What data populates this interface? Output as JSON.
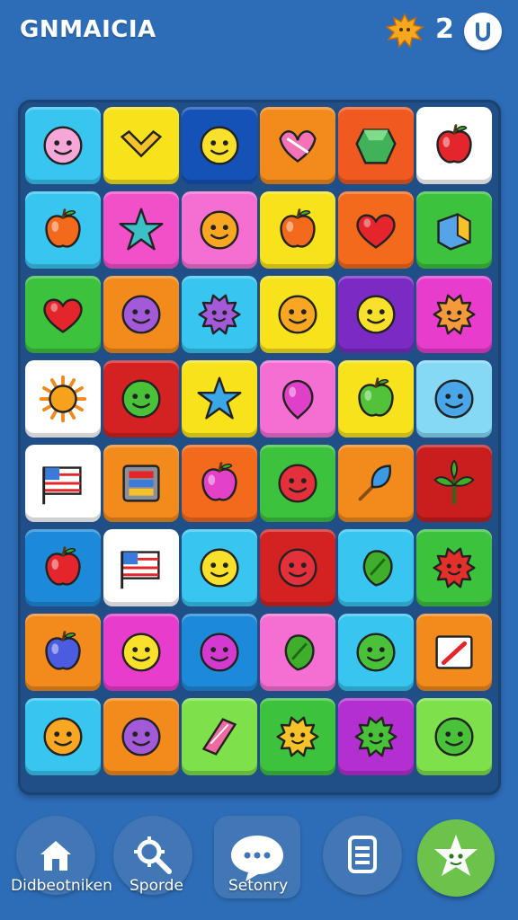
{
  "header": {
    "title": "GNMAICIA",
    "count": "2",
    "coin_icon": "sun-coin-icon",
    "profile_icon": "power-icon"
  },
  "board": {
    "rows": [
      [
        {
          "bg": "#38c6f0",
          "icon": "face-blob"
        },
        {
          "bg": "#f7e21b",
          "icon": "heart-ribbon"
        },
        {
          "bg": "#1552b8",
          "icon": "face-yellow"
        },
        {
          "bg": "#f38a1c",
          "icon": "heart-ribbon-pink"
        },
        {
          "bg": "#f05a20",
          "icon": "gem-green"
        },
        {
          "bg": "#ffffff",
          "icon": "apple-red"
        }
      ],
      [
        {
          "bg": "#38c6f0",
          "icon": "apple-orange"
        },
        {
          "bg": "#f250c9",
          "icon": "star-burst"
        },
        {
          "bg": "#f46fd1",
          "icon": "face-orange"
        },
        {
          "bg": "#f7e21b",
          "icon": "apple-orange"
        },
        {
          "bg": "#f46a1c",
          "icon": "heart-red"
        },
        {
          "bg": "#3cc23c",
          "icon": "box-blue"
        }
      ],
      [
        {
          "bg": "#3cc23c",
          "icon": "heart-red"
        },
        {
          "bg": "#f38a1c",
          "icon": "face-purple"
        },
        {
          "bg": "#38c6f0",
          "icon": "spiky-purple"
        },
        {
          "bg": "#f7e21b",
          "icon": "face-orange"
        },
        {
          "bg": "#7b2bc4",
          "icon": "face-yellow"
        },
        {
          "bg": "#e83ccd",
          "icon": "spiky-orange"
        }
      ],
      [
        {
          "bg": "#ffffff",
          "icon": "sun"
        },
        {
          "bg": "#d42121",
          "icon": "face-green"
        },
        {
          "bg": "#f7e21b",
          "icon": "star-blue"
        },
        {
          "bg": "#f46fd1",
          "icon": "drop-pink"
        },
        {
          "bg": "#f7e21b",
          "icon": "apple-green"
        },
        {
          "bg": "#86d9f5",
          "icon": "face-blue"
        }
      ],
      [
        {
          "bg": "#ffffff",
          "icon": "flag"
        },
        {
          "bg": "#f38a1c",
          "icon": "machine"
        },
        {
          "bg": "#f46a1c",
          "icon": "apple-pink"
        },
        {
          "bg": "#3cc23c",
          "icon": "face-red"
        },
        {
          "bg": "#f38a1c",
          "icon": "leaf-blue"
        },
        {
          "bg": "#c91e1e",
          "icon": "plant"
        }
      ],
      [
        {
          "bg": "#1d8ad9",
          "icon": "apple-red"
        },
        {
          "bg": "#ffffff",
          "icon": "flag"
        },
        {
          "bg": "#38c6f0",
          "icon": "face-yellow"
        },
        {
          "bg": "#d42121",
          "icon": "face-red"
        },
        {
          "bg": "#38c6f0",
          "icon": "leaf-green"
        },
        {
          "bg": "#3cc23c",
          "icon": "spiky-red"
        }
      ],
      [
        {
          "bg": "#f38a1c",
          "icon": "apple-blue"
        },
        {
          "bg": "#e83ccd",
          "icon": "face-yellow"
        },
        {
          "bg": "#1d8ad9",
          "icon": "face-magenta"
        },
        {
          "bg": "#f46fd1",
          "icon": "leaf-green"
        },
        {
          "bg": "#38c6f0",
          "icon": "face-green"
        },
        {
          "bg": "#f38a1c",
          "icon": "card"
        }
      ],
      [
        {
          "bg": "#38c6f0",
          "icon": "face-orange"
        },
        {
          "bg": "#f38a1c",
          "icon": "face-purple"
        },
        {
          "bg": "#7ee04a",
          "icon": "gem-pink"
        },
        {
          "bg": "#3cc23c",
          "icon": "spiky-yellow"
        },
        {
          "bg": "#b42fd0",
          "icon": "spiky-green"
        },
        {
          "bg": "#7ee04a",
          "icon": "face-green"
        }
      ]
    ]
  },
  "nav": {
    "items": [
      {
        "label": "Didbeotniken",
        "icon": "home-icon"
      },
      {
        "label": "Sporde",
        "icon": "search-icon"
      },
      {
        "label": "Setonry",
        "icon": "chat-icon"
      },
      {
        "label": "",
        "icon": "document-icon"
      }
    ],
    "play_icon": "sparkle-face-icon"
  }
}
